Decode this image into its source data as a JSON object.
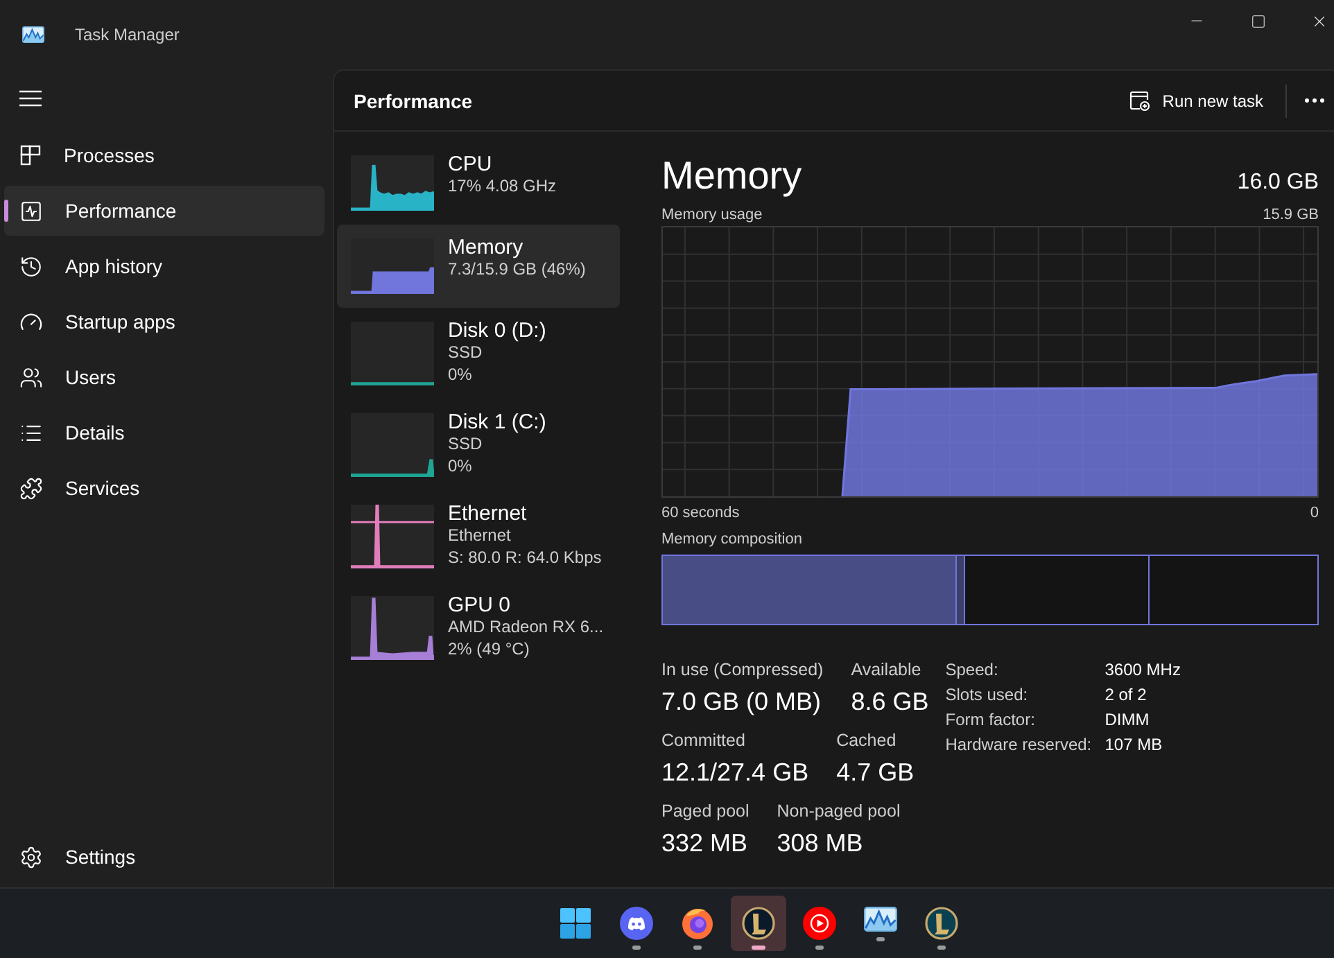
{
  "window": {
    "title": "Task Manager"
  },
  "sidebar": {
    "items": [
      {
        "label": "Processes",
        "selected": false
      },
      {
        "label": "Performance",
        "selected": true
      },
      {
        "label": "App history",
        "selected": false
      },
      {
        "label": "Startup apps",
        "selected": false
      },
      {
        "label": "Users",
        "selected": false
      },
      {
        "label": "Details",
        "selected": false
      },
      {
        "label": "Services",
        "selected": false
      }
    ],
    "settings": {
      "label": "Settings"
    }
  },
  "header": {
    "title": "Performance",
    "run_new_task": "Run new task"
  },
  "devices": [
    {
      "name": "CPU",
      "lines": [
        "17% 4.08 GHz"
      ],
      "color": "#29b3c6",
      "selected": false
    },
    {
      "name": "Memory",
      "lines": [
        "7.3/15.9 GB (46%)"
      ],
      "color": "#7076dc",
      "selected": true
    },
    {
      "name": "Disk 0 (D:)",
      "lines": [
        "SSD",
        "0%"
      ],
      "color": "#1fa594",
      "selected": false
    },
    {
      "name": "Disk 1 (C:)",
      "lines": [
        "SSD",
        "0%"
      ],
      "color": "#1fa594",
      "selected": false
    },
    {
      "name": "Ethernet",
      "lines": [
        "Ethernet",
        "S: 80.0 R: 64.0 Kbps"
      ],
      "color": "#e27dbb",
      "selected": false
    },
    {
      "name": "GPU 0",
      "lines": [
        "AMD Radeon RX 6...",
        "2% (49 °C)"
      ],
      "color": "#a77fd6",
      "selected": false
    }
  ],
  "detail": {
    "title": "Memory",
    "capacity": "16.0 GB",
    "usage_label": "Memory usage",
    "usage_max": "15.9 GB",
    "time_start": "60 seconds",
    "time_end": "0",
    "composition_label": "Memory composition",
    "stats": [
      [
        {
          "label": "In use (Compressed)",
          "value": "7.0 GB (0 MB)"
        },
        {
          "label": "Available",
          "value": "8.6 GB"
        }
      ],
      [
        {
          "label": "Committed",
          "value": "12.1/27.4 GB"
        },
        {
          "label": "Cached",
          "value": "4.7 GB"
        }
      ],
      [
        {
          "label": "Paged pool",
          "value": "332 MB"
        },
        {
          "label": "Non-paged pool",
          "value": "308 MB"
        }
      ]
    ],
    "specs": [
      {
        "label": "Speed:",
        "value": "3600 MHz"
      },
      {
        "label": "Slots used:",
        "value": "2 of 2"
      },
      {
        "label": "Form factor:",
        "value": "DIMM"
      },
      {
        "label": "Hardware reserved:",
        "value": "107 MB"
      }
    ]
  },
  "taskbar": {
    "items": [
      {
        "running": false,
        "selected": false
      },
      {
        "running": true,
        "selected": false
      },
      {
        "running": true,
        "selected": false
      },
      {
        "running": true,
        "selected": true
      },
      {
        "running": true,
        "selected": false
      },
      {
        "running": true,
        "selected": false
      },
      {
        "running": true,
        "selected": false
      }
    ]
  }
}
